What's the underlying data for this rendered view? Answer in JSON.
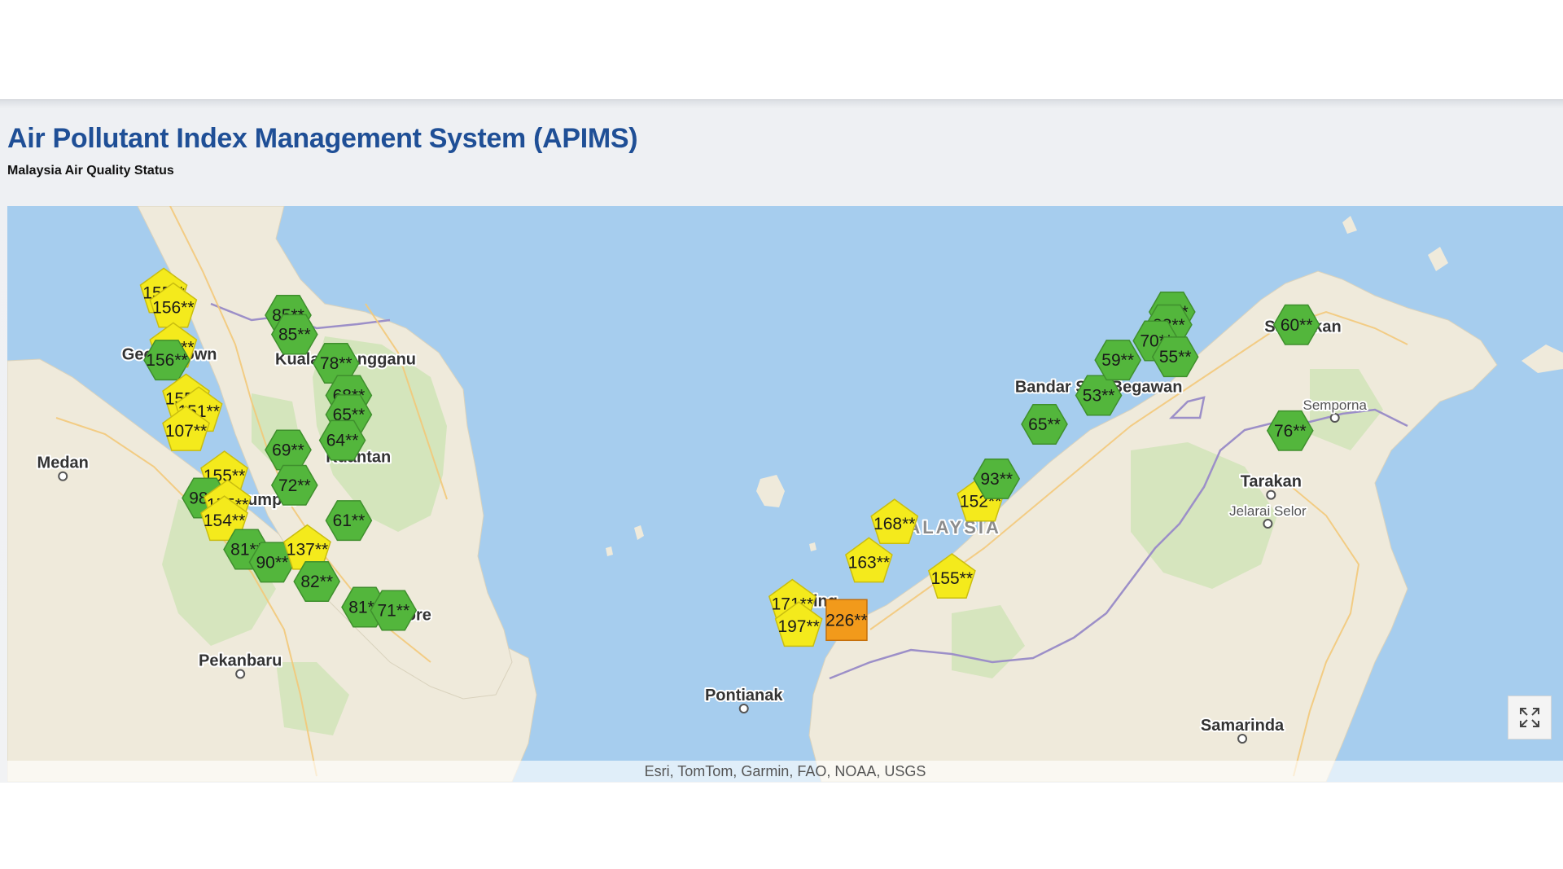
{
  "header": {
    "title": "Air Pollutant Index Management System (APIMS)",
    "subtitle": "Malaysia Air Quality Status"
  },
  "map": {
    "attribution": "Esri, TomTom, Garmin, FAO, NOAA, USGS",
    "fullscreen_icon": "expand-icon",
    "colors": {
      "sea": "#a6cdee",
      "land": "#efeadb",
      "forest": "#cde3b4",
      "good": "#53b63c",
      "moderate": "#f4ea1c",
      "unhealthy": "#f29a1b"
    },
    "places": [
      {
        "name": "Medan",
        "lon": 98.67,
        "lat": 3.59,
        "dot": true
      },
      {
        "name": "Pekanbaru",
        "lon": 101.45,
        "lat": 0.51,
        "dot": true
      },
      {
        "name": "Pontianak",
        "lon": 109.34,
        "lat": -0.03,
        "dot": true
      },
      {
        "name": "Samarinda",
        "lon": 117.15,
        "lat": -0.5,
        "dot": true
      },
      {
        "name": "Tarakan",
        "lon": 117.6,
        "lat": 3.3,
        "dot": true
      },
      {
        "name": "Jelarai Selor",
        "lon": 117.55,
        "lat": 2.85,
        "dot": true,
        "small": true
      },
      {
        "name": "Semporna",
        "lon": 118.6,
        "lat": 4.5,
        "dot": true,
        "small": true
      },
      {
        "name": "Sandakan",
        "lon": 118.1,
        "lat": 5.84,
        "dot": false
      },
      {
        "name": "Georgetown",
        "lon": 100.34,
        "lat": 5.41,
        "dot": false
      },
      {
        "name": "Kuala Terengganu",
        "lon": 103.1,
        "lat": 5.33,
        "dot": false
      },
      {
        "name": "Kuantan",
        "lon": 103.3,
        "lat": 3.81,
        "dot": false
      },
      {
        "name": "Kuala Lumpur",
        "lon": 101.5,
        "lat": 3.14,
        "dot": false
      },
      {
        "name": "Singapore",
        "lon": 103.82,
        "lat": 1.35,
        "dot": false
      },
      {
        "name": "Kuching",
        "lon": 110.3,
        "lat": 1.56,
        "dot": false
      },
      {
        "name": "Bandar Seri Begawan",
        "lon": 114.9,
        "lat": 4.9,
        "dot": false
      },
      {
        "name": "MALAYSIA",
        "lon": 112.5,
        "lat": 2.7,
        "dot": false,
        "country": true
      }
    ],
    "stations": [
      {
        "label": "155**",
        "lon": 100.25,
        "lat": 6.45,
        "status": "moderate"
      },
      {
        "label": "156**",
        "lon": 100.4,
        "lat": 6.22,
        "status": "moderate"
      },
      {
        "label": "162**",
        "lon": 100.4,
        "lat": 5.6,
        "status": "moderate"
      },
      {
        "label": "156**",
        "lon": 100.3,
        "lat": 5.4,
        "status": "good"
      },
      {
        "label": "155**",
        "lon": 100.6,
        "lat": 4.8,
        "status": "moderate"
      },
      {
        "label": "151**",
        "lon": 100.8,
        "lat": 4.6,
        "status": "moderate"
      },
      {
        "label": "107**",
        "lon": 100.6,
        "lat": 4.3,
        "status": "moderate"
      },
      {
        "label": "155**",
        "lon": 101.2,
        "lat": 3.6,
        "status": "moderate"
      },
      {
        "label": "98**",
        "lon": 100.9,
        "lat": 3.25,
        "status": "good"
      },
      {
        "label": "155**",
        "lon": 101.25,
        "lat": 3.15,
        "status": "moderate"
      },
      {
        "label": "154**",
        "lon": 101.2,
        "lat": 2.9,
        "status": "moderate"
      },
      {
        "label": "85**",
        "lon": 102.2,
        "lat": 6.1,
        "status": "good"
      },
      {
        "label": "85**",
        "lon": 102.3,
        "lat": 5.8,
        "status": "good"
      },
      {
        "label": "78**",
        "lon": 102.95,
        "lat": 5.35,
        "status": "good"
      },
      {
        "label": "68**",
        "lon": 103.15,
        "lat": 4.85,
        "status": "good"
      },
      {
        "label": "65**",
        "lon": 103.15,
        "lat": 4.55,
        "status": "good"
      },
      {
        "label": "64**",
        "lon": 103.05,
        "lat": 4.15,
        "status": "good"
      },
      {
        "label": "69**",
        "lon": 102.2,
        "lat": 4.0,
        "status": "good"
      },
      {
        "label": "72**",
        "lon": 102.3,
        "lat": 3.45,
        "status": "good"
      },
      {
        "label": "61**",
        "lon": 103.15,
        "lat": 2.9,
        "status": "good"
      },
      {
        "label": "81**",
        "lon": 101.55,
        "lat": 2.45,
        "status": "good"
      },
      {
        "label": "90**",
        "lon": 101.95,
        "lat": 2.25,
        "status": "good"
      },
      {
        "label": "137**",
        "lon": 102.5,
        "lat": 2.45,
        "status": "moderate"
      },
      {
        "label": "82**",
        "lon": 102.65,
        "lat": 1.95,
        "status": "good"
      },
      {
        "label": "81**",
        "lon": 103.4,
        "lat": 1.55,
        "status": "good"
      },
      {
        "label": "71**",
        "lon": 103.85,
        "lat": 1.5,
        "status": "good"
      },
      {
        "label": "171**",
        "lon": 110.1,
        "lat": 1.6,
        "status": "moderate"
      },
      {
        "label": "197**",
        "lon": 110.2,
        "lat": 1.25,
        "status": "moderate"
      },
      {
        "label": "226**",
        "lon": 110.95,
        "lat": 1.35,
        "status": "unhealthy"
      },
      {
        "label": "163**",
        "lon": 111.3,
        "lat": 2.25,
        "status": "moderate"
      },
      {
        "label": "168**",
        "lon": 111.7,
        "lat": 2.85,
        "status": "moderate"
      },
      {
        "label": "155**",
        "lon": 112.6,
        "lat": 2.0,
        "status": "moderate"
      },
      {
        "label": "152**",
        "lon": 113.05,
        "lat": 3.2,
        "status": "moderate"
      },
      {
        "label": "93**",
        "lon": 113.3,
        "lat": 3.55,
        "status": "good"
      },
      {
        "label": "65**",
        "lon": 114.05,
        "lat": 4.4,
        "status": "good"
      },
      {
        "label": "53**",
        "lon": 114.9,
        "lat": 4.85,
        "status": "good"
      },
      {
        "label": "59**",
        "lon": 115.2,
        "lat": 5.4,
        "status": "good"
      },
      {
        "label": "59**",
        "lon": 116.05,
        "lat": 6.15,
        "status": "good"
      },
      {
        "label": "83**",
        "lon": 116.0,
        "lat": 5.95,
        "status": "good"
      },
      {
        "label": "70**",
        "lon": 115.8,
        "lat": 5.7,
        "status": "good"
      },
      {
        "label": "55**",
        "lon": 116.1,
        "lat": 5.45,
        "status": "good"
      },
      {
        "label": "60**",
        "lon": 118.0,
        "lat": 5.95,
        "status": "good"
      },
      {
        "label": "76**",
        "lon": 117.9,
        "lat": 4.3,
        "status": "good"
      }
    ]
  }
}
